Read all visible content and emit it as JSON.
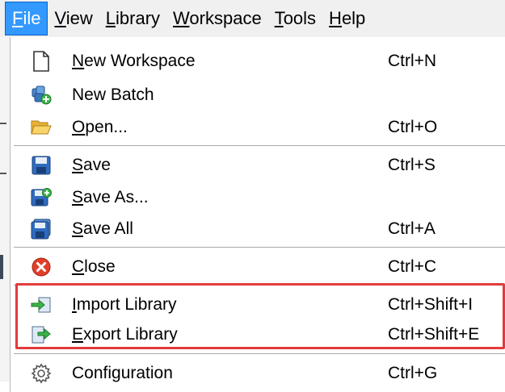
{
  "menubar": {
    "items": [
      {
        "label": "File"
      },
      {
        "label": "View"
      },
      {
        "label": "Library"
      },
      {
        "label": "Workspace"
      },
      {
        "label": "Tools"
      },
      {
        "label": "Help"
      }
    ]
  },
  "file_menu": {
    "items": [
      {
        "label": "New Workspace",
        "shortcut": "Ctrl+N",
        "icon": "new-document-icon"
      },
      {
        "label": "New Batch",
        "shortcut": "",
        "icon": "new-batch-icon"
      },
      {
        "label": "Open...",
        "shortcut": "Ctrl+O",
        "icon": "folder-open-icon"
      },
      {
        "label": "Save",
        "shortcut": "Ctrl+S",
        "icon": "save-icon"
      },
      {
        "label": "Save As...",
        "shortcut": "",
        "icon": "save-as-icon"
      },
      {
        "label": "Save All",
        "shortcut": "Ctrl+A",
        "icon": "save-all-icon"
      },
      {
        "label": "Close",
        "shortcut": "Ctrl+C",
        "icon": "close-icon"
      },
      {
        "label": "Import Library",
        "shortcut": "Ctrl+Shift+I",
        "icon": "import-icon"
      },
      {
        "label": "Export Library",
        "shortcut": "Ctrl+Shift+E",
        "icon": "export-icon"
      },
      {
        "label": "Configuration",
        "shortcut": "Ctrl+G",
        "icon": "gear-icon"
      }
    ]
  },
  "colors": {
    "menubar_active": "#3399ff",
    "highlight_box": "#e23b3b"
  }
}
